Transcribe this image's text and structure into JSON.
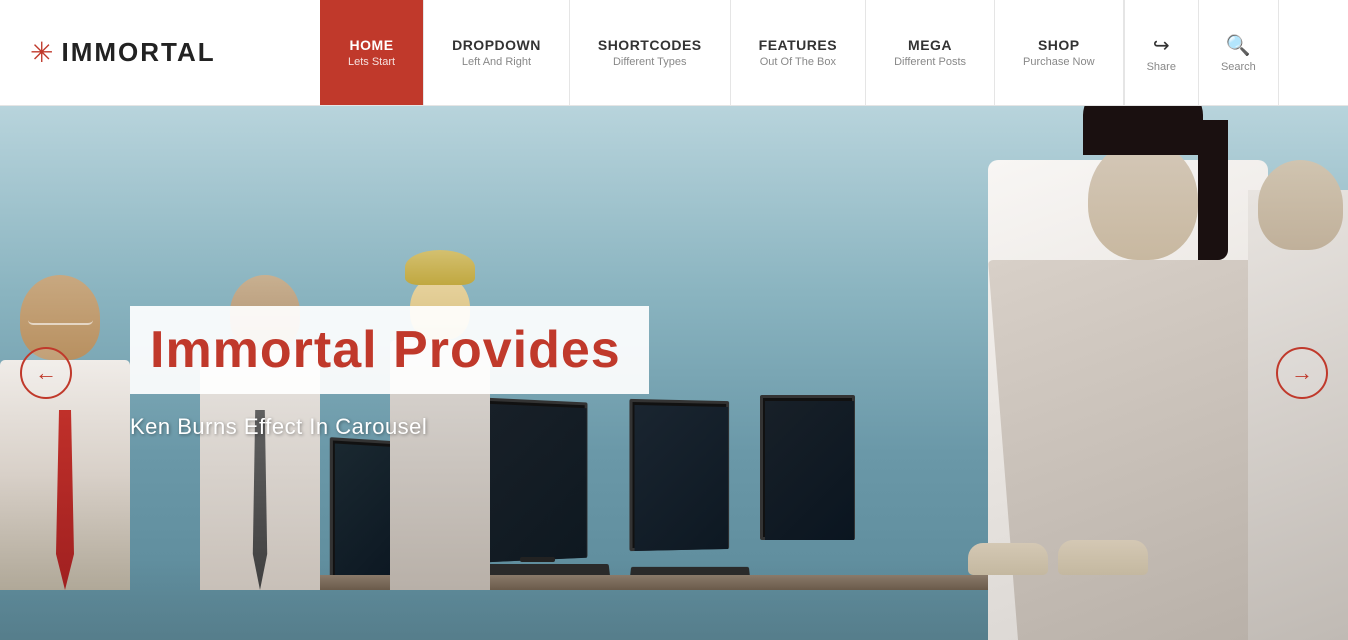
{
  "logo": {
    "icon": "✳",
    "text": "IMMORTAL"
  },
  "nav": {
    "items": [
      {
        "id": "home",
        "main": "HOME",
        "sub": "Lets Start",
        "active": true
      },
      {
        "id": "dropdown",
        "main": "DROPDOWN",
        "sub": "Left And Right",
        "active": false
      },
      {
        "id": "shortcodes",
        "main": "SHORTCODES",
        "sub": "Different Types",
        "active": false
      },
      {
        "id": "features",
        "main": "FEATURES",
        "sub": "Out Of The Box",
        "active": false
      },
      {
        "id": "mega",
        "main": "MEGA",
        "sub": "Different Posts",
        "active": false
      },
      {
        "id": "shop",
        "main": "SHOP",
        "sub": "Purchase Now",
        "active": false
      }
    ],
    "share": {
      "icon": "↪",
      "label": "Share"
    },
    "search": {
      "icon": "🔍",
      "label": "Search"
    }
  },
  "hero": {
    "title": "Immortal Provides",
    "subtitle": "Ken Burns Effect In Carousel"
  },
  "carousel": {
    "prev_icon": "←",
    "next_icon": "→"
  }
}
